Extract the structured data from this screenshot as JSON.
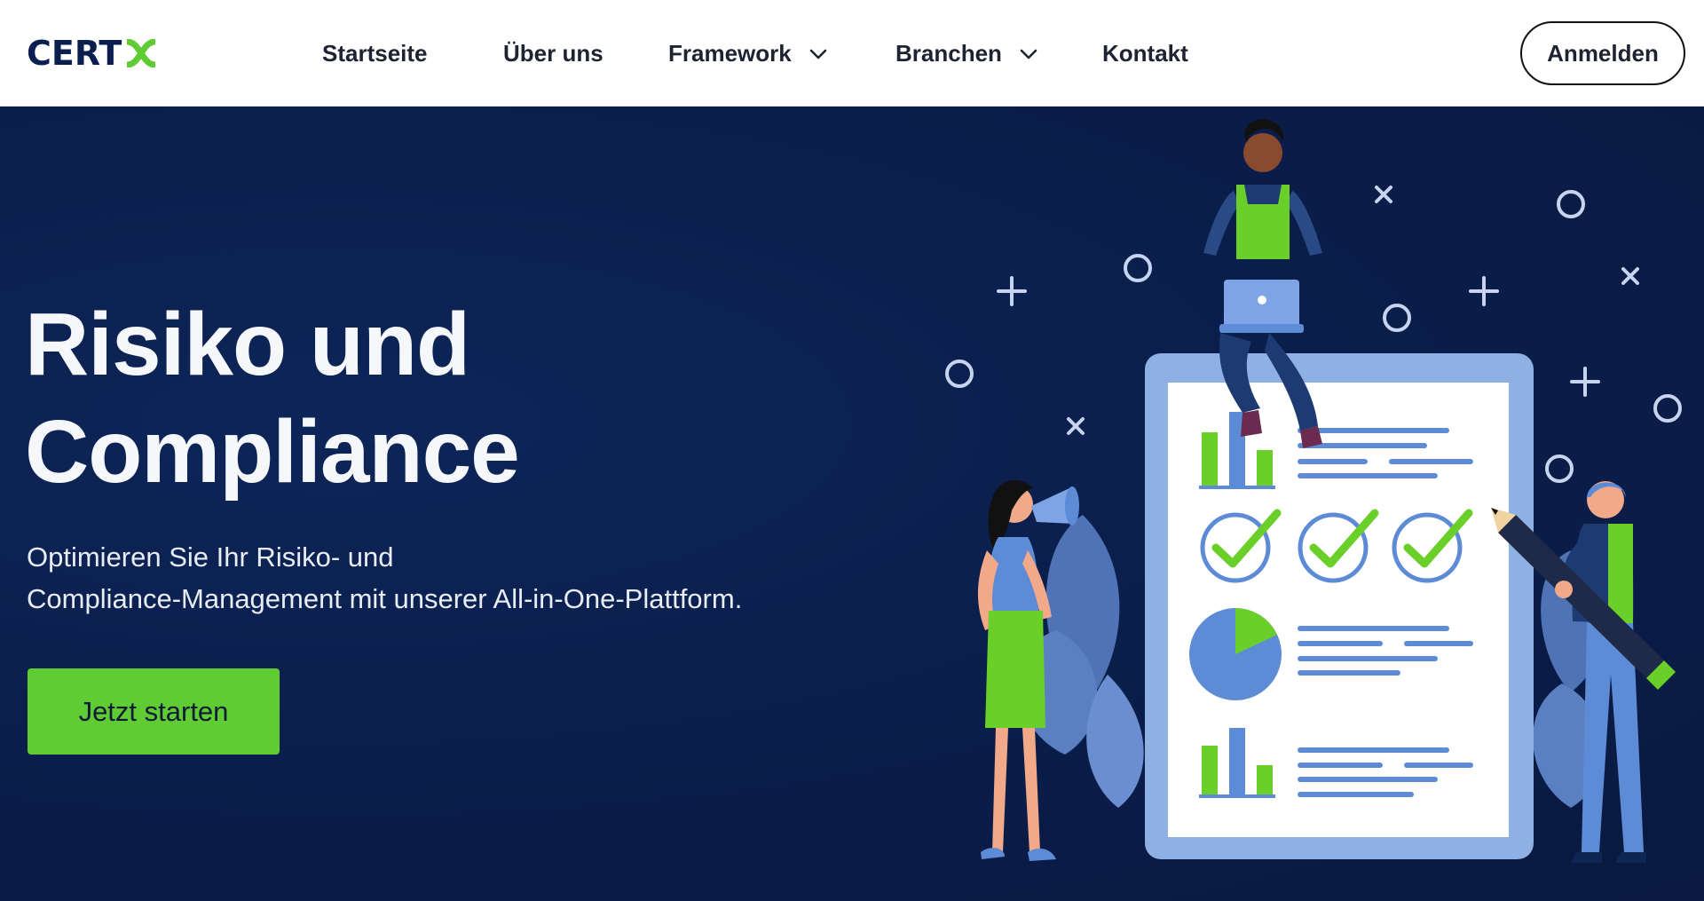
{
  "brand": {
    "logo_main": "CERT",
    "logo_accent": "X",
    "logo_color": "#0a1f4f",
    "accent_color": "#5fcc34"
  },
  "nav": {
    "items": [
      {
        "label": "Startseite",
        "has_dropdown": false
      },
      {
        "label": "Über uns",
        "has_dropdown": false
      },
      {
        "label": "Framework",
        "has_dropdown": true
      },
      {
        "label": "Branchen",
        "has_dropdown": true
      },
      {
        "label": "Kontakt",
        "has_dropdown": false
      }
    ],
    "login_label": "Anmelden"
  },
  "hero": {
    "title_line1": "Risiko und",
    "title_line2": "Compliance",
    "subtitle_line1": "Optimieren Sie Ihr Risiko- und",
    "subtitle_line2": "Compliance-Management mit unserer All-in-One-Plattform.",
    "cta_label": "Jetzt starten",
    "background_color": "#0b1f4a",
    "illustration_icons": [
      "chevron-down-icon",
      "checkmark-circle-icon",
      "bar-chart-icon",
      "pie-chart-icon",
      "megaphone-icon",
      "laptop-icon",
      "pencil-icon"
    ]
  }
}
